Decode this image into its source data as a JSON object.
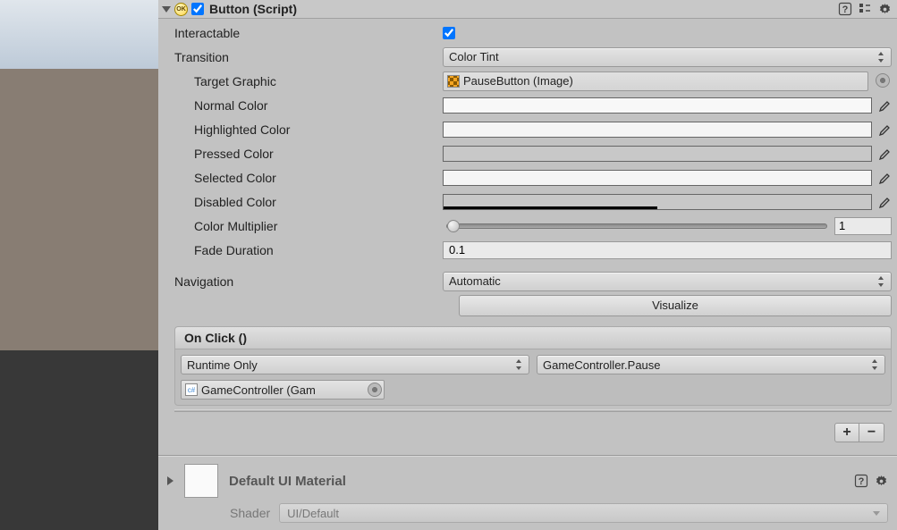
{
  "header": {
    "title": "Button (Script)",
    "enabled": true
  },
  "props": {
    "interactable_label": "Interactable",
    "interactable_val": true,
    "transition_label": "Transition",
    "transition_val": "Color Tint",
    "target_graphic_label": "Target Graphic",
    "target_graphic_val": "PauseButton (Image)",
    "normal_color_label": "Normal Color",
    "highlighted_color_label": "Highlighted Color",
    "pressed_color_label": "Pressed Color",
    "selected_color_label": "Selected Color",
    "disabled_color_label": "Disabled Color",
    "color_multiplier_label": "Color Multiplier",
    "color_multiplier_val": "1",
    "fade_duration_label": "Fade Duration",
    "fade_duration_val": "0.1",
    "navigation_label": "Navigation",
    "navigation_val": "Automatic",
    "visualize_label": "Visualize"
  },
  "colors": {
    "normal": "#f8f8f8",
    "highlighted": "#f5f5f5",
    "pressed": "#c8c8c8",
    "selected": "#f5f5f5",
    "disabled": "#c8c8c8",
    "disabled_alpha_pct": 50
  },
  "onclick": {
    "title": "On Click ()",
    "runtime": "Runtime Only",
    "method": "GameController.Pause",
    "target": "GameController (Gam"
  },
  "material": {
    "name": "Default UI Material",
    "shader_label": "Shader",
    "shader_val": "UI/Default"
  },
  "icons": {
    "ok": "OK",
    "plus": "+",
    "minus": "−"
  }
}
